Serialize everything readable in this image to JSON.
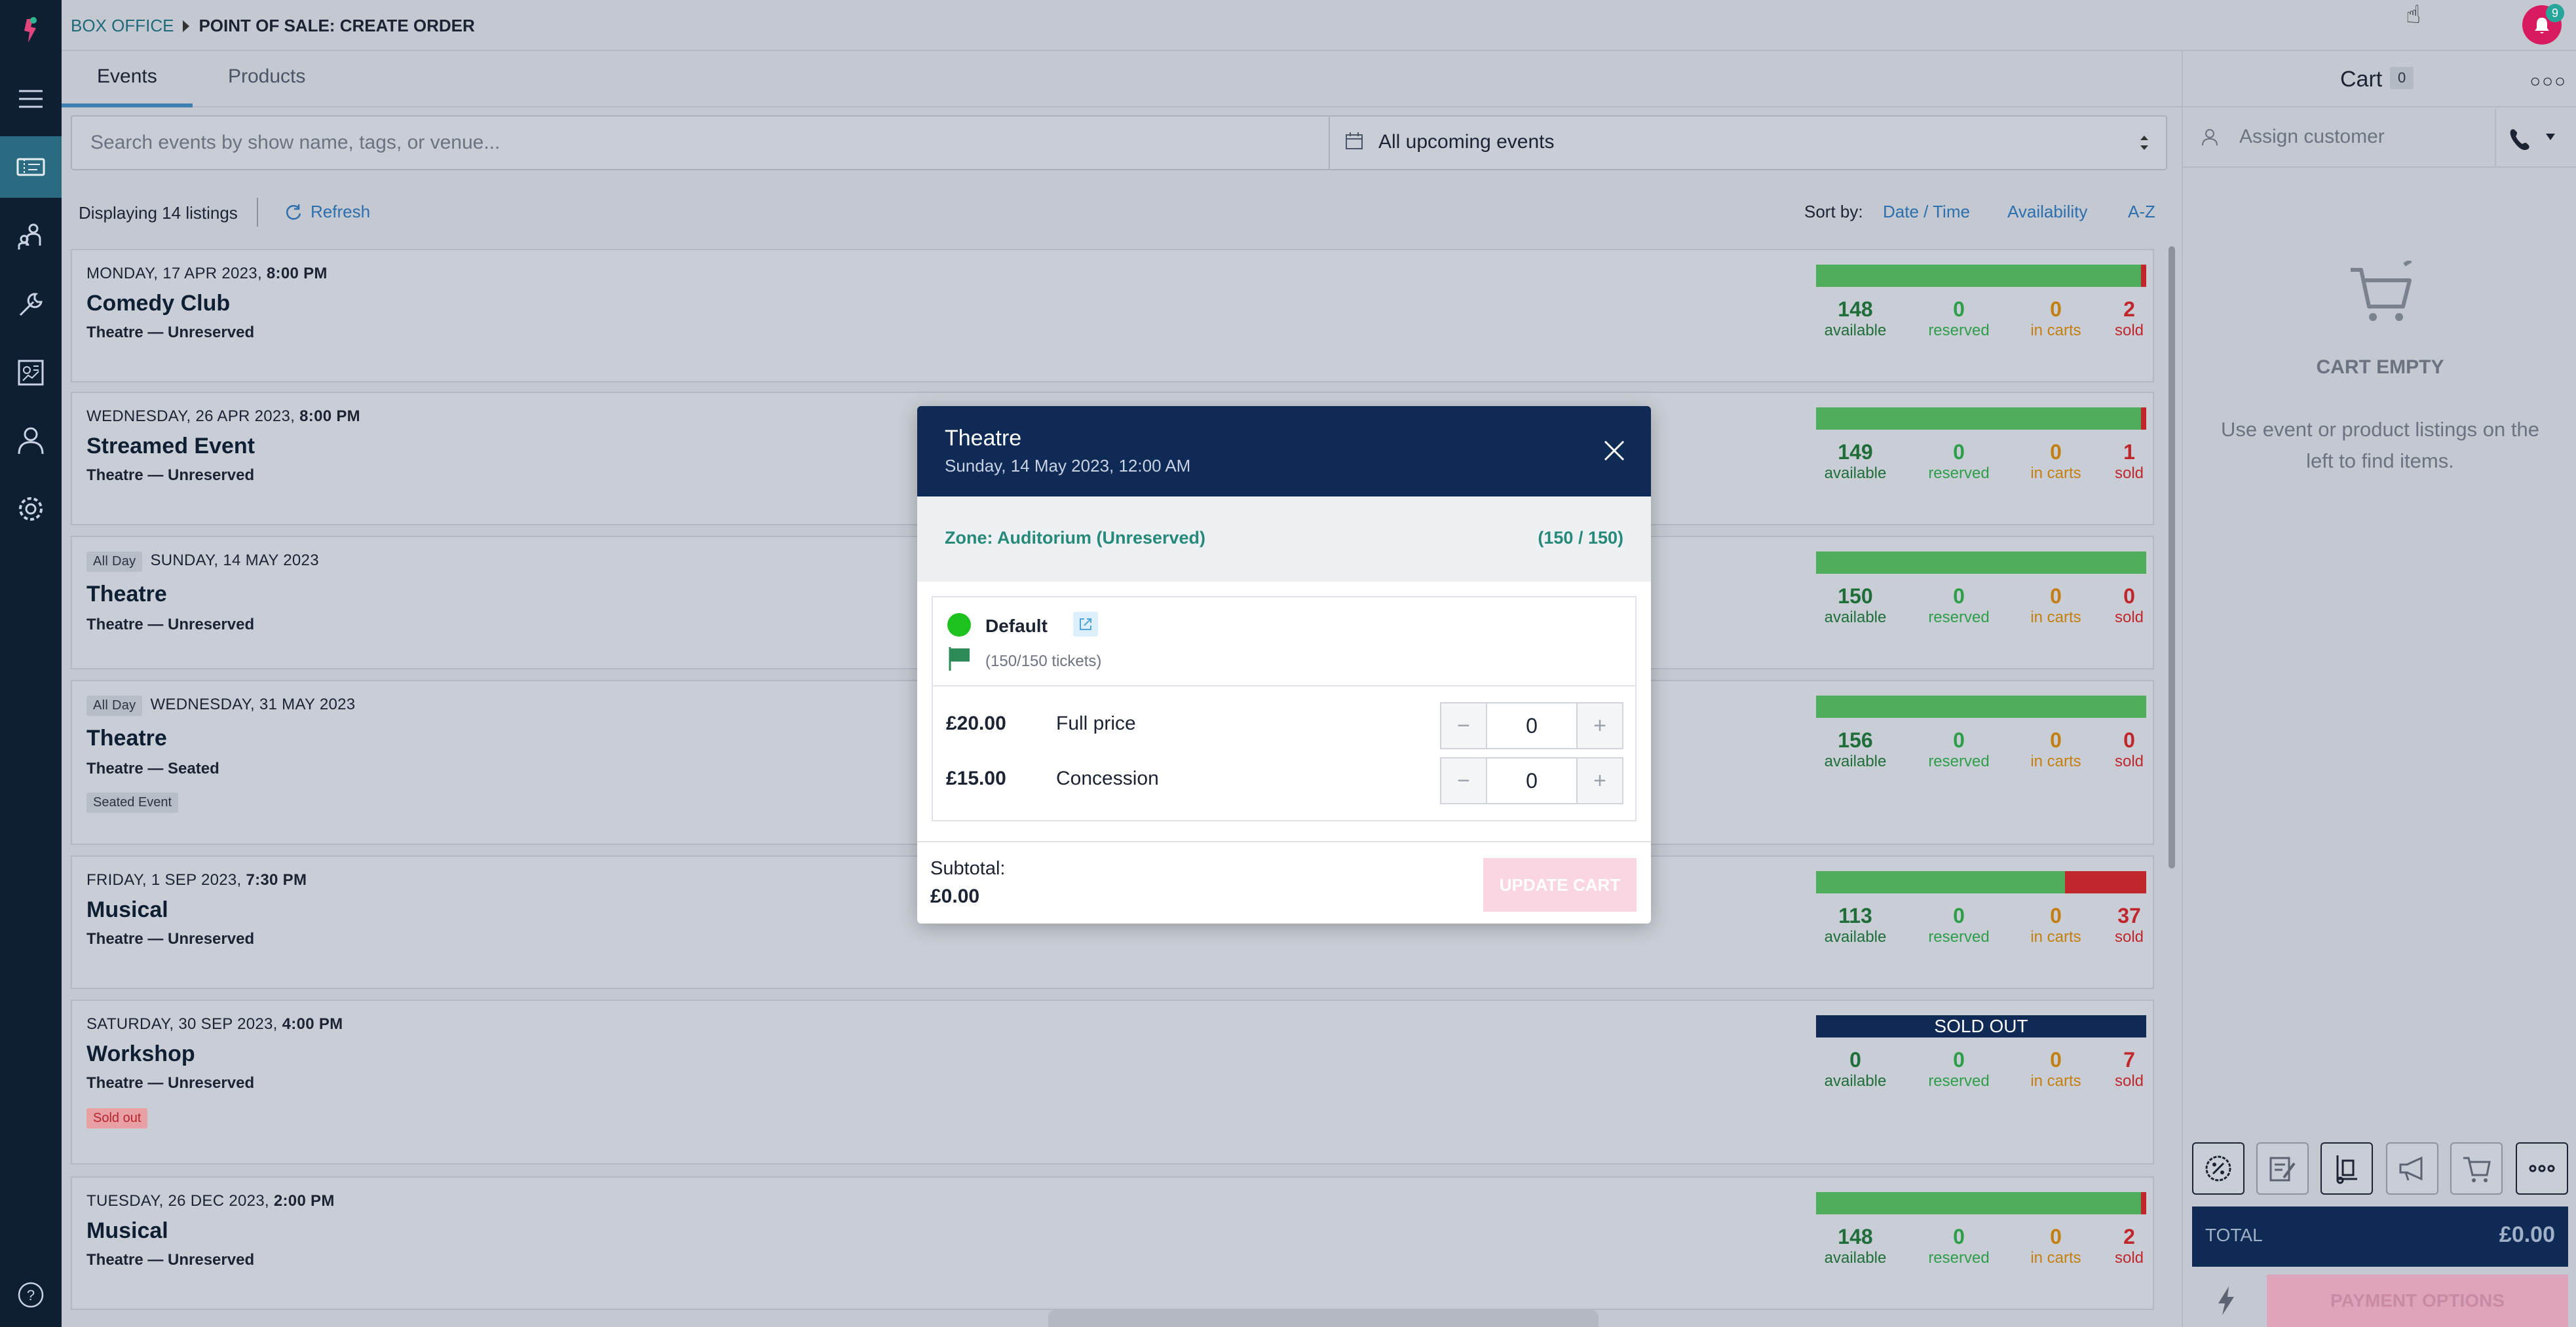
{
  "breadcrumb": {
    "section": "BOX OFFICE",
    "page": "POINT OF SALE: CREATE ORDER"
  },
  "notifications": {
    "count": "9"
  },
  "tabs": [
    {
      "label": "Events"
    },
    {
      "label": "Products"
    }
  ],
  "search": {
    "placeholder": "Search events by show name, tags, or venue...",
    "value": ""
  },
  "filter": {
    "selected": "All upcoming events"
  },
  "listbar": {
    "displaying": "Displaying 14 listings",
    "refresh": "Refresh",
    "sort_by": "Sort by:",
    "sort_options": [
      "Date / Time",
      "Availability",
      "A-Z"
    ]
  },
  "stat_labels": {
    "available": "available",
    "reserved": "reserved",
    "in_carts": "in carts",
    "sold": "sold"
  },
  "listings": [
    {
      "all_day": "",
      "date": "MONDAY, 17 APR 2023, ",
      "time": "8:00 PM",
      "name": "Comedy Club",
      "venue": "Theatre — Unreserved",
      "tag": "",
      "available": "148",
      "reserved": "0",
      "in_carts": "0",
      "sold": "2",
      "sold_fraction": 0.013
    },
    {
      "all_day": "",
      "date": "WEDNESDAY, 26 APR 2023, ",
      "time": "8:00 PM",
      "name": "Streamed Event",
      "venue": "Theatre — Unreserved",
      "tag": "",
      "available": "149",
      "reserved": "0",
      "in_carts": "0",
      "sold": "1",
      "sold_fraction": 0.007
    },
    {
      "all_day": "All Day",
      "date": "SUNDAY, 14 MAY 2023",
      "time": "",
      "name": "Theatre",
      "venue": "Theatre — Unreserved",
      "tag": "",
      "available": "150",
      "reserved": "0",
      "in_carts": "0",
      "sold": "0",
      "sold_fraction": 0
    },
    {
      "all_day": "All Day",
      "date": "WEDNESDAY, 31 MAY 2023",
      "time": "",
      "name": "Theatre",
      "venue": "Theatre — Seated",
      "tag": "Seated Event",
      "available": "156",
      "reserved": "0",
      "in_carts": "0",
      "sold": "0",
      "sold_fraction": 0
    },
    {
      "all_day": "",
      "date": "FRIDAY, 1 SEP 2023, ",
      "time": "7:30 PM",
      "name": "Musical",
      "venue": "Theatre — Unreserved",
      "tag": "",
      "available": "113",
      "reserved": "0",
      "in_carts": "0",
      "sold": "37",
      "sold_fraction": 0.247
    },
    {
      "all_day": "",
      "date": "SATURDAY, 30 SEP 2023, ",
      "time": "4:00 PM",
      "name": "Workshop",
      "venue": "Theatre — Unreserved",
      "tag": "Sold out",
      "available": "0",
      "reserved": "0",
      "in_carts": "0",
      "sold": "7",
      "sold_fraction": 1,
      "bar_label": "SOLD OUT"
    },
    {
      "all_day": "",
      "date": "TUESDAY, 26 DEC 2023, ",
      "time": "2:00 PM",
      "name": "Musical",
      "venue": "Theatre — Unreserved",
      "tag": "",
      "available": "148",
      "reserved": "0",
      "in_carts": "0",
      "sold": "2",
      "sold_fraction": 0.013
    }
  ],
  "cart": {
    "title": "Cart",
    "count": "0",
    "assign_placeholder": "Assign customer",
    "empty_title": "CART EMPTY",
    "empty_message": "Use event or product listings on the left to find items.",
    "total_label": "TOTAL",
    "total_value": "£0.00",
    "payment_label": "PAYMENT OPTIONS"
  },
  "modal": {
    "title": "Theatre",
    "subtitle": "Sunday, 14 May 2023, 12:00 AM",
    "zone": "Zone: Auditorium (Unreserved)",
    "zone_count": "(150 / 150)",
    "allocation": "Default",
    "tickets": "(150/150 tickets)",
    "prices": [
      {
        "amount": "£20.00",
        "type": "Full price",
        "qty": "0"
      },
      {
        "amount": "£15.00",
        "type": "Concession",
        "qty": "0"
      }
    ],
    "subtotal_label": "Subtotal:",
    "subtotal_value": "£0.00",
    "update_button": "UPDATE CART"
  },
  "colors": {
    "nav_bg": "#0e1f34",
    "accent": "#2a6b82",
    "available_bar": "#4fad5b",
    "sold_bar": "#c0272d",
    "modal_header": "#0e2a55",
    "zone_text": "#26897a"
  }
}
